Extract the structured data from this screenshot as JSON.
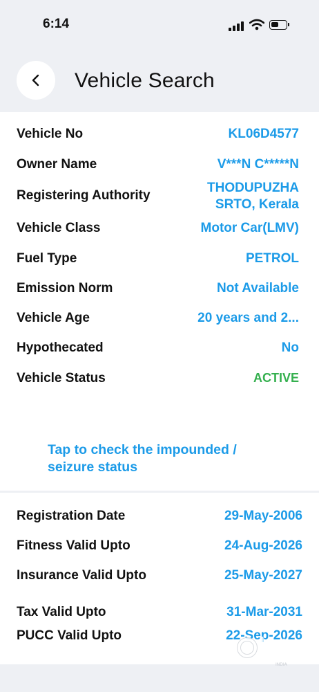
{
  "status_bar": {
    "time": "6:14"
  },
  "header": {
    "title": "Vehicle Search"
  },
  "vehicle_details": [
    {
      "label": "Vehicle No",
      "value": "KL06D4577"
    },
    {
      "label": "Owner Name",
      "value": "V***N C*****N"
    },
    {
      "label": "Registering Authority",
      "value": "THODUPUZHA SRTO, Kerala"
    },
    {
      "label": "Vehicle Class",
      "value": "Motor Car(LMV)"
    },
    {
      "label": "Fuel Type",
      "value": "PETROL"
    },
    {
      "label": "Emission Norm",
      "value": "Not Available"
    },
    {
      "label": "Vehicle Age",
      "value": "20 years and 2..."
    },
    {
      "label": "Hypothecated",
      "value": "No"
    },
    {
      "label": "Vehicle Status",
      "value": "ACTIVE"
    }
  ],
  "impound_link": "Tap to check the impounded / seizure status",
  "validity_details": [
    {
      "label": "Registration Date",
      "value": "29-May-2006"
    },
    {
      "label": "Fitness Valid Upto",
      "value": "24-Aug-2026"
    },
    {
      "label": "Insurance Valid Upto",
      "value": "25-May-2027"
    },
    {
      "label": "Tax Valid Upto",
      "value": "31-Mar-2031"
    },
    {
      "label": "PUCC Valid Upto",
      "value": "22-Sep-2026"
    }
  ],
  "watermark": {
    "brand": "olx",
    "sub": "INDIA"
  },
  "colors": {
    "accent": "#1c9be8",
    "active": "#35b04f",
    "background": "#eef0f4"
  },
  "icons": [
    "signal-icon",
    "wifi-icon",
    "battery-icon",
    "back-chevron-icon"
  ]
}
